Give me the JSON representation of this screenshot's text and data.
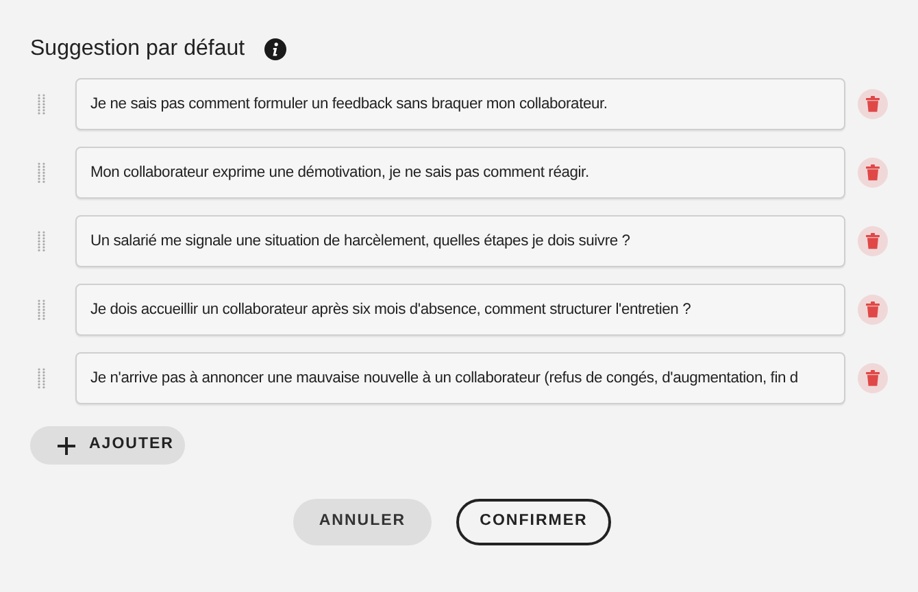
{
  "title": "Suggestion par défaut",
  "suggestions": [
    {
      "value": "Je ne sais pas comment formuler un feedback sans braquer mon collaborateur."
    },
    {
      "value": "Mon collaborateur exprime une démotivation, je ne sais pas comment réagir."
    },
    {
      "value": "Un salarié me signale une situation de harcèlement, quelles étapes je dois suivre ?"
    },
    {
      "value": "Je dois accueillir un collaborateur après six mois d'absence, comment structurer l'entretien ?"
    },
    {
      "value": "Je n'arrive pas à annoncer une mauvaise nouvelle à un collaborateur (refus de congés, d'augmentation, fin d"
    }
  ],
  "add_button": "AJOUTER",
  "buttons": [
    {
      "label": "ANNULER",
      "kind": "secondary"
    },
    {
      "label": "CONFIRMER",
      "kind": "outline"
    }
  ]
}
